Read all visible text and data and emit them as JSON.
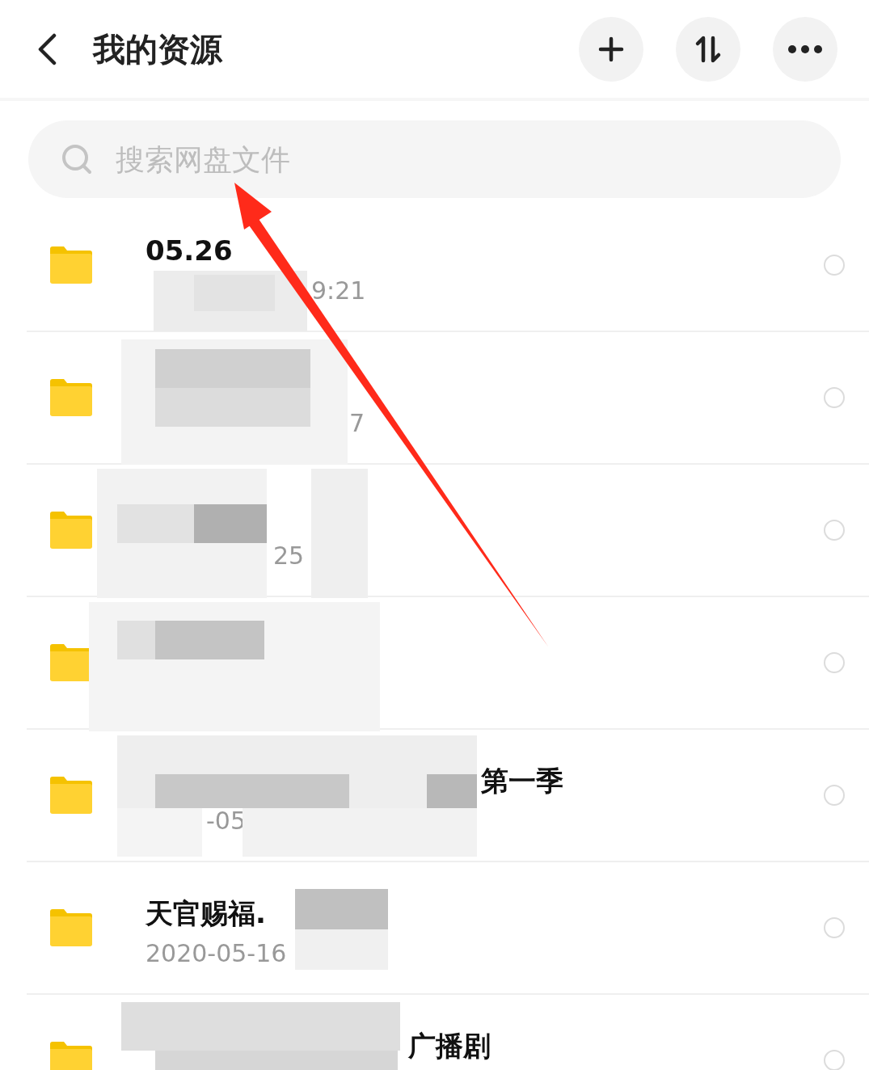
{
  "header": {
    "title": "我的资源"
  },
  "search": {
    "placeholder": "搜索网盘文件"
  },
  "files": [
    {
      "name": "05.26",
      "date": "9:21",
      "selected": false
    },
    {
      "date": "7",
      "selected": false
    },
    {
      "date": "25",
      "selected": false
    },
    {
      "selected": false
    },
    {
      "name": "第一季",
      "date": "-05",
      "selected": false
    },
    {
      "name": "天官赐福.",
      "date": "2020-05-16",
      "selected": false
    },
    {
      "name": "广播剧",
      "selected": false
    }
  ]
}
